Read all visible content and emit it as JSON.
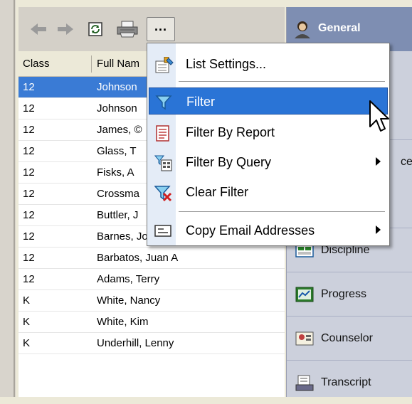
{
  "toolbar": {
    "more_label": "..."
  },
  "list": {
    "headers": {
      "class": "Class",
      "full_name": "Full Nam"
    },
    "rows": [
      {
        "class": "12",
        "name": "Johnson"
      },
      {
        "class": "12",
        "name": "Johnson"
      },
      {
        "class": "12",
        "name": "James, ©"
      },
      {
        "class": "12",
        "name": "Glass, T"
      },
      {
        "class": "12",
        "name": "Fisks, A"
      },
      {
        "class": "12",
        "name": "Crossma"
      },
      {
        "class": "12",
        "name": "Buttler, J"
      },
      {
        "class": "12",
        "name": "Barnes, Joe"
      },
      {
        "class": "12",
        "name": "Barbatos, Juan A"
      },
      {
        "class": "12",
        "name": "Adams, Terry"
      },
      {
        "class": "K",
        "name": "White, Nancy"
      },
      {
        "class": "K",
        "name": "White, Kim"
      },
      {
        "class": "K",
        "name": "Underhill, Lenny"
      }
    ]
  },
  "menu": {
    "items": [
      {
        "label": "List Settings...",
        "icon": "list-settings-icon"
      },
      {
        "label": "Filter",
        "icon": "filter-icon"
      },
      {
        "label": "Filter By Report",
        "icon": "report-icon"
      },
      {
        "label": "Filter By Query",
        "icon": "query-icon"
      },
      {
        "label": "Clear Filter",
        "icon": "clear-filter-icon"
      },
      {
        "label": "Copy Email Addresses",
        "icon": "email-icon"
      }
    ]
  },
  "panel": {
    "general": "General",
    "partial_labels": [
      "ce"
    ],
    "items": [
      {
        "label": "Discipline"
      },
      {
        "label": "Progress"
      },
      {
        "label": "Counselor"
      },
      {
        "label": "Transcript"
      }
    ]
  },
  "colors": {
    "selection": "#3a7bd5",
    "menu_highlight": "#2a74d6",
    "panel_header": "#7e8eb2"
  }
}
